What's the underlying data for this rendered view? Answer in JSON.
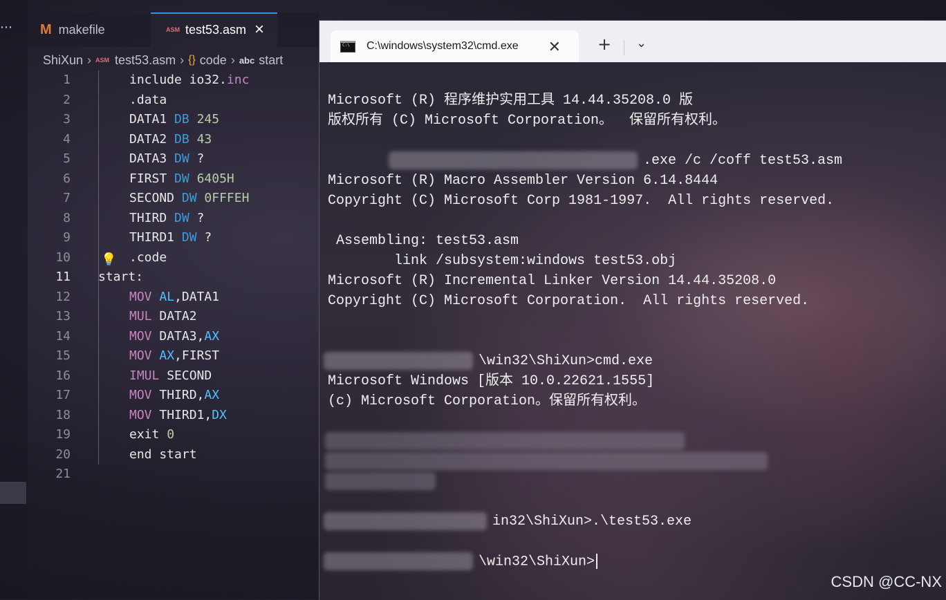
{
  "editor": {
    "tabs": [
      {
        "label": "makefile",
        "icon": "makefile-icon"
      },
      {
        "label": "test53.asm",
        "icon": "asm-file-icon",
        "badge": "ASM"
      }
    ],
    "breadcrumb": {
      "folder": "ShiXun",
      "file": "test53.asm",
      "section": "code",
      "symbol": "start",
      "symbol_prefix": "abc"
    },
    "code_lines": [
      {
        "n": "1",
        "parts": [
          [
            "include io32.",
            ""
          ],
          [
            "inc",
            "inc"
          ]
        ],
        "indent": true
      },
      {
        "n": "2",
        "parts": [
          [
            ".data",
            ""
          ]
        ],
        "indent": true
      },
      {
        "n": "3",
        "parts": [
          [
            "DATA1 ",
            ""
          ],
          [
            "DB",
            "typ"
          ],
          [
            " ",
            ""
          ],
          [
            "245",
            "num"
          ]
        ],
        "indent": true
      },
      {
        "n": "4",
        "parts": [
          [
            "DATA2 ",
            ""
          ],
          [
            "DB",
            "typ"
          ],
          [
            " ",
            ""
          ],
          [
            "43",
            "num"
          ]
        ],
        "indent": true
      },
      {
        "n": "5",
        "parts": [
          [
            "DATA3 ",
            ""
          ],
          [
            "DW",
            "typ"
          ],
          [
            " ?",
            ""
          ]
        ],
        "indent": true
      },
      {
        "n": "6",
        "parts": [
          [
            "FIRST ",
            ""
          ],
          [
            "DW",
            "typ"
          ],
          [
            " ",
            ""
          ],
          [
            "6405H",
            "num"
          ]
        ],
        "indent": true
      },
      {
        "n": "7",
        "parts": [
          [
            "SECOND ",
            ""
          ],
          [
            "DW",
            "typ"
          ],
          [
            " ",
            ""
          ],
          [
            "0FFFEH",
            "num"
          ]
        ],
        "indent": true
      },
      {
        "n": "8",
        "parts": [
          [
            "THIRD ",
            ""
          ],
          [
            "DW",
            "typ"
          ],
          [
            " ?",
            ""
          ]
        ],
        "indent": true
      },
      {
        "n": "9",
        "parts": [
          [
            "THIRD1 ",
            ""
          ],
          [
            "DW",
            "typ"
          ],
          [
            " ?",
            ""
          ]
        ],
        "indent": true
      },
      {
        "n": "10",
        "parts": [
          [
            ".code",
            ""
          ]
        ],
        "indent": true,
        "bulb": true
      },
      {
        "n": "11",
        "parts": [
          [
            "start:",
            ""
          ]
        ],
        "indent": false,
        "current": true
      },
      {
        "n": "12",
        "parts": [
          [
            "MOV",
            "kw"
          ],
          [
            " ",
            ""
          ],
          [
            "AL",
            "reg"
          ],
          [
            ",DATA1",
            ""
          ]
        ],
        "indent": true
      },
      {
        "n": "13",
        "parts": [
          [
            "MUL",
            "kw"
          ],
          [
            " DATA2",
            ""
          ]
        ],
        "indent": true
      },
      {
        "n": "14",
        "parts": [
          [
            "MOV",
            "kw"
          ],
          [
            " DATA3,",
            ""
          ],
          [
            "AX",
            "reg"
          ]
        ],
        "indent": true
      },
      {
        "n": "15",
        "parts": [
          [
            "MOV",
            "kw"
          ],
          [
            " ",
            ""
          ],
          [
            "AX",
            "reg"
          ],
          [
            ",FIRST",
            ""
          ]
        ],
        "indent": true
      },
      {
        "n": "16",
        "parts": [
          [
            "IMUL",
            "kw"
          ],
          [
            " SECOND",
            ""
          ]
        ],
        "indent": true
      },
      {
        "n": "17",
        "parts": [
          [
            "MOV",
            "kw"
          ],
          [
            " THIRD,",
            ""
          ],
          [
            "AX",
            "reg"
          ]
        ],
        "indent": true
      },
      {
        "n": "18",
        "parts": [
          [
            "MOV",
            "kw"
          ],
          [
            " THIRD1,",
            ""
          ],
          [
            "DX",
            "reg"
          ]
        ],
        "indent": true
      },
      {
        "n": "19",
        "parts": [
          [
            "exit ",
            ""
          ],
          [
            "0",
            "num"
          ]
        ],
        "indent": true
      },
      {
        "n": "20",
        "parts": [
          [
            "end start",
            ""
          ]
        ],
        "indent": true
      },
      {
        "n": "21",
        "parts": [
          [
            "",
            ""
          ]
        ],
        "indent": false
      }
    ]
  },
  "terminal": {
    "tab_title": "C:\\windows\\system32\\cmd.exe",
    "lines": [
      {
        "text": "Microsoft (R) 程序维护实用工具 14.44.35208.0 版"
      },
      {
        "text": "版权所有 (C) Microsoft Corporation。  保留所有权利。"
      },
      {
        "text": ""
      },
      {
        "text": ".exe /c /coff test53.asm",
        "offset": 468,
        "blurred_prefix": true
      },
      {
        "text": "Microsoft (R) Macro Assembler Version 6.14.8444"
      },
      {
        "text": "Copyright (C) Microsoft Corp 1981-1997.  All rights reserved."
      },
      {
        "text": ""
      },
      {
        "text": " Assembling: test53.asm"
      },
      {
        "text": "        link /subsystem:windows test53.obj"
      },
      {
        "text": "Microsoft (R) Incremental Linker Version 14.44.35208.0"
      },
      {
        "text": "Copyright (C) Microsoft Corporation.  All rights reserved."
      },
      {
        "text": ""
      },
      {
        "text": ""
      },
      {
        "text": "\\win32\\ShiXun>cmd.exe",
        "offset": 230,
        "blurred_prefix": true
      },
      {
        "text": "Microsoft Windows [版本 10.0.22621.1555]"
      },
      {
        "text": "(c) Microsoft Corporation。保留所有权利。"
      },
      {
        "text": ""
      },
      {
        "text": "",
        "blurred_full": true
      },
      {
        "text": "",
        "blurred_full": true
      },
      {
        "text": "",
        "blurred_full": true
      },
      {
        "text": ""
      },
      {
        "text": "in32\\ShiXun>.\\test53.exe",
        "offset": 250,
        "blurred_prefix": true
      },
      {
        "text": ""
      },
      {
        "text": "\\win32\\ShiXun>",
        "offset": 230,
        "blurred_prefix": true,
        "cursor": true
      }
    ]
  },
  "watermark": "CSDN @CC-NX"
}
